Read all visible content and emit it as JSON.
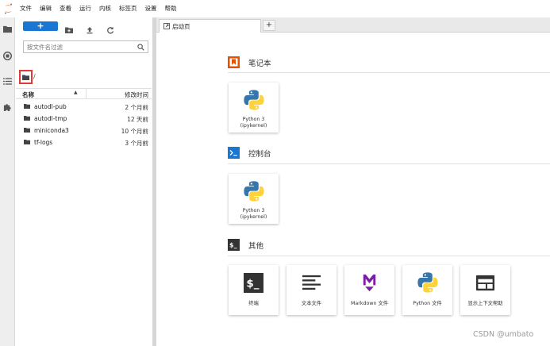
{
  "menubar": {
    "items": [
      "文件",
      "编辑",
      "查看",
      "运行",
      "内核",
      "标签页",
      "设置",
      "帮助"
    ]
  },
  "activity_bar": {
    "icons": [
      "folder-icon",
      "running-icon",
      "toc-icon",
      "extension-icon"
    ]
  },
  "file_browser": {
    "new_label": "+",
    "filter_placeholder": "按文件名过滤",
    "breadcrumb_separator": "/",
    "columns": {
      "name": "名称",
      "sort_indicator": "▲",
      "modified": "修改时间"
    },
    "files": [
      {
        "name": "autodl-pub",
        "modified": "2 个月前"
      },
      {
        "name": "autodl-tmp",
        "modified": "12 天前"
      },
      {
        "name": "miniconda3",
        "modified": "10 个月前"
      },
      {
        "name": "tf-logs",
        "modified": "3 个月前"
      }
    ]
  },
  "main": {
    "tab_label": "启动页",
    "add_tab_label": "+",
    "sections": {
      "notebook": {
        "title": "笔记本",
        "card_label": "Python 3\n(ipykernel)"
      },
      "console": {
        "title": "控制台",
        "card_label": "Python 3\n(ipykernel)"
      },
      "other": {
        "title": "其他",
        "cards": [
          {
            "label": "终端",
            "icon": "terminal-icon"
          },
          {
            "label": "文本文件",
            "icon": "text-file-icon"
          },
          {
            "label": "Markdown 文件",
            "icon": "markdown-icon"
          },
          {
            "label": "Python 文件",
            "icon": "python-icon"
          },
          {
            "label": "显示上下文帮助",
            "icon": "context-help-icon"
          }
        ]
      }
    }
  },
  "watermark": "CSDN @umbato",
  "colors": {
    "accent": "#1976d2",
    "notebook_orange": "#e65100",
    "console_blue": "#1976d2",
    "other_dark": "#333333",
    "markdown_purple": "#7b1fa2",
    "highlight_red": "#e53935"
  }
}
